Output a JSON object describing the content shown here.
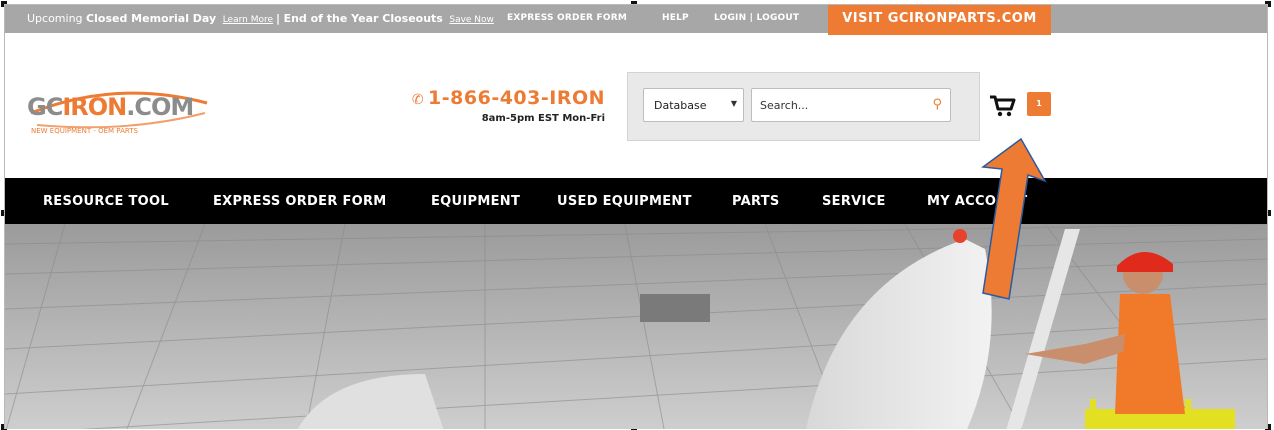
{
  "topbar": {
    "promo_prefix": "Upcoming",
    "promo_bold1": "Closed Memorial Day",
    "promo_link1": "Learn More",
    "promo_sep": "|",
    "promo_bold2": "End of the Year Closeouts",
    "promo_link2": "Save Now",
    "links": [
      "EXPRESS ORDER FORM",
      "HELP",
      "LOGIN | LOGOUT"
    ],
    "visit_label": "VISIT GCIRONPARTS.COM"
  },
  "header": {
    "logo_text_gc": "GC",
    "logo_text_iron": "IRON",
    "logo_text_com": ".COM",
    "logo_tagline": "NEW EQUIPMENT - OEM PARTS",
    "phone": "1-866-403-IRON",
    "hours": "8am-5pm EST Mon-Fri",
    "search_category": "Database",
    "search_placeholder": "Search...",
    "cart_count": "1"
  },
  "nav": {
    "items": [
      "RESOURCE TOOL",
      "EXPRESS ORDER FORM",
      "EQUIPMENT",
      "USED EQUIPMENT",
      "PARTS",
      "SERVICE",
      "MY ACCOUNT"
    ]
  },
  "colors": {
    "accent": "#ee7b33",
    "topbar": "#a7a7a7",
    "nav": "#000000"
  },
  "icons": {
    "phone": "phone-icon",
    "search": "search-icon",
    "cart": "cart-icon",
    "dropdown": "chevron-down-icon"
  }
}
